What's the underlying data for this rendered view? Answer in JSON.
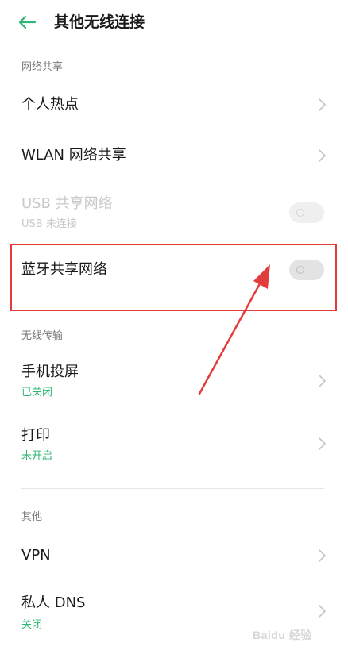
{
  "header": {
    "title": "其他无线连接"
  },
  "sections": {
    "network_sharing": "网络共享",
    "wireless_transfer": "无线传输",
    "other": "其他"
  },
  "rows": {
    "hotspot": {
      "title": "个人热点"
    },
    "wlan_share": {
      "title": "WLAN 网络共享"
    },
    "usb_share": {
      "title": "USB 共享网络",
      "subtitle": "USB 未连接",
      "toggle_on": false,
      "enabled": false
    },
    "bt_share": {
      "title": "蓝牙共享网络",
      "toggle_on": false
    },
    "screen_cast": {
      "title": "手机投屏",
      "subtitle": "已关闭"
    },
    "print": {
      "title": "打印",
      "subtitle": "未开启"
    },
    "vpn": {
      "title": "VPN"
    },
    "private_dns": {
      "title": "私人 DNS",
      "subtitle": "关闭"
    }
  },
  "watermark": "Baidu 经验",
  "colors": {
    "accent": "#2fb574",
    "highlight": "#e23b3b",
    "disabled": "#c9c9c9"
  }
}
